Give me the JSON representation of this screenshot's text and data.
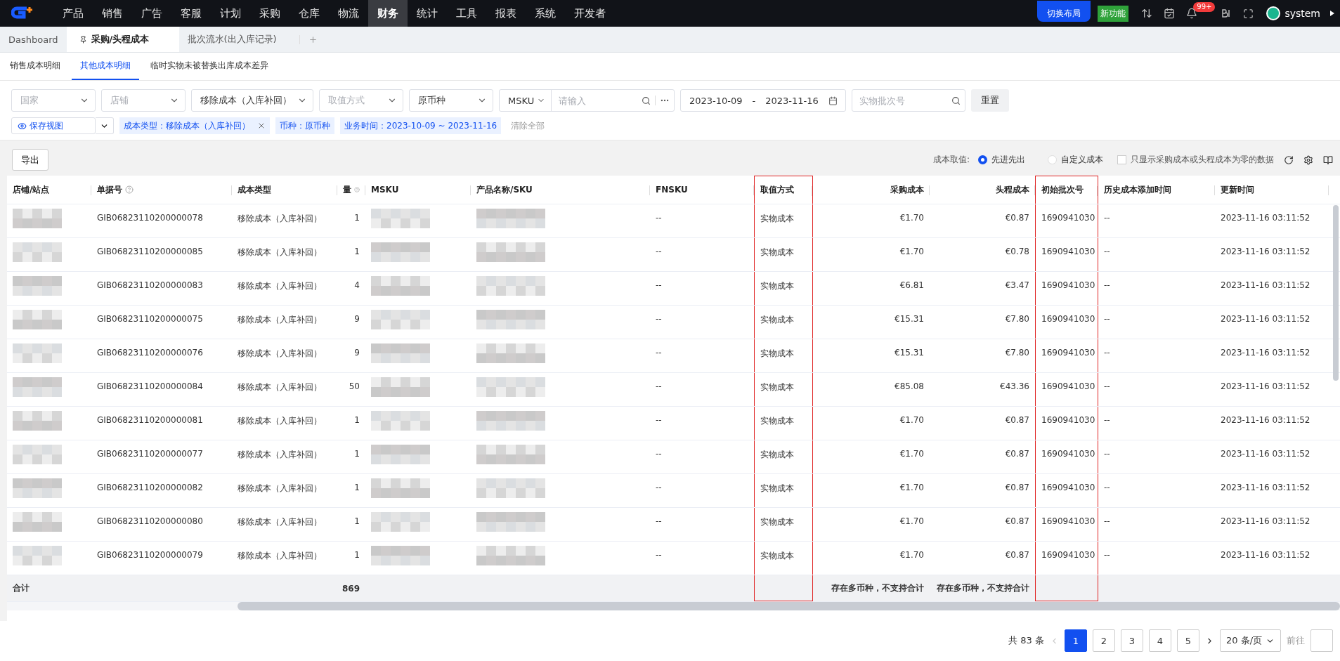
{
  "nav": {
    "items": [
      {
        "label": "产品",
        "selected": false
      },
      {
        "label": "销售",
        "selected": false
      },
      {
        "label": "广告",
        "selected": false
      },
      {
        "label": "客服",
        "selected": false
      },
      {
        "label": "计划",
        "selected": false
      },
      {
        "label": "采购",
        "selected": false
      },
      {
        "label": "仓库",
        "selected": false
      },
      {
        "label": "物流",
        "selected": false
      },
      {
        "label": "财务",
        "selected": true
      },
      {
        "label": "统计",
        "selected": false
      },
      {
        "label": "工具",
        "selected": false
      },
      {
        "label": "报表",
        "selected": false
      },
      {
        "label": "系统",
        "selected": false
      },
      {
        "label": "开发者",
        "selected": false
      }
    ],
    "switch_layout": "切换布局",
    "new_feature": "新功能",
    "notification_count": "99+",
    "user": "system"
  },
  "tabs": [
    {
      "label": "Dashboard",
      "selected": false,
      "pinned": false
    },
    {
      "label": "采购/头程成本",
      "selected": true,
      "pinned": true
    },
    {
      "label": "批次流水(出入库记录)",
      "selected": false,
      "pinned": false
    }
  ],
  "subtabs": [
    {
      "label": "销售成本明细",
      "selected": false
    },
    {
      "label": "其他成本明细",
      "selected": true
    },
    {
      "label": "临时实物未被替换出库成本差异",
      "selected": false
    }
  ],
  "filters": [
    {
      "kind": "select",
      "placeholder": "国家"
    },
    {
      "kind": "select",
      "placeholder": "店铺"
    },
    {
      "kind": "select",
      "value": "移除成本（入库补回）"
    },
    {
      "kind": "select",
      "placeholder": "取值方式"
    },
    {
      "kind": "select",
      "value": "原币种"
    },
    {
      "kind": "msku",
      "value": "MSKU",
      "placeholder": "请输入"
    },
    {
      "kind": "daterange",
      "start": "2023-10-09",
      "separator": "-",
      "end": "2023-11-16"
    },
    {
      "kind": "search",
      "placeholder": "实物批次号"
    },
    {
      "kind": "button",
      "label": "重置"
    }
  ],
  "save_view": "保存视图",
  "chips": [
    {
      "text": "成本类型：移除成本（入库补回）",
      "removable": true
    },
    {
      "text": "币种：原币种",
      "removable": false
    },
    {
      "text": "业务时间：2023-10-09 ~ 2023-11-16",
      "removable": false
    }
  ],
  "clear_all": "清除全部",
  "export": "导出",
  "cost_mode": {
    "label": "成本取值:",
    "options": [
      {
        "label": "先进先出",
        "selected": true
      },
      {
        "label": "自定义成本",
        "selected": false
      }
    ]
  },
  "only_zero": {
    "label": "只显示采购成本或头程成本为零的数据",
    "checked": false
  },
  "table": {
    "columns": [
      {
        "label": "店铺/站点",
        "help": false,
        "highlighted": false
      },
      {
        "label": "单据号",
        "help": true,
        "highlighted": false
      },
      {
        "label": "成本类型",
        "help": false,
        "highlighted": false
      },
      {
        "label": "量",
        "help": true,
        "highlighted": false
      },
      {
        "label": "MSKU",
        "help": false,
        "highlighted": false
      },
      {
        "label": "产品名称/SKU",
        "help": false,
        "highlighted": false
      },
      {
        "label": "FNSKU",
        "help": false,
        "highlighted": false
      },
      {
        "label": "取值方式",
        "help": false,
        "highlighted": true
      },
      {
        "label": "采购成本",
        "help": false,
        "highlighted": false
      },
      {
        "label": "头程成本",
        "help": false,
        "highlighted": false
      },
      {
        "label": "初始批次号",
        "help": false,
        "highlighted": true
      },
      {
        "label": "历史成本添加时间",
        "help": false,
        "highlighted": false
      },
      {
        "label": "更新时间",
        "help": false,
        "highlighted": false
      }
    ],
    "rows": [
      {
        "doc": "GIB06823110200000078",
        "type": "移除成本（入库补回）",
        "qty": "1",
        "fnsku": "--",
        "method": "实物成本",
        "purchase": "€1.70",
        "freight": "€0.87",
        "batch": "1690941030",
        "history": "--",
        "updated": "2023-11-16 03:11:52"
      },
      {
        "doc": "GIB06823110200000085",
        "type": "移除成本（入库补回）",
        "qty": "1",
        "fnsku": "--",
        "method": "实物成本",
        "purchase": "€1.70",
        "freight": "€0.78",
        "batch": "1690941030",
        "history": "--",
        "updated": "2023-11-16 03:11:52"
      },
      {
        "doc": "GIB06823110200000083",
        "type": "移除成本（入库补回）",
        "qty": "4",
        "fnsku": "--",
        "method": "实物成本",
        "purchase": "€6.81",
        "freight": "€3.47",
        "batch": "1690941030",
        "history": "--",
        "updated": "2023-11-16 03:11:52"
      },
      {
        "doc": "GIB06823110200000075",
        "type": "移除成本（入库补回）",
        "qty": "9",
        "fnsku": "--",
        "method": "实物成本",
        "purchase": "€15.31",
        "freight": "€7.80",
        "batch": "1690941030",
        "history": "--",
        "updated": "2023-11-16 03:11:52"
      },
      {
        "doc": "GIB06823110200000076",
        "type": "移除成本（入库补回）",
        "qty": "9",
        "fnsku": "--",
        "method": "实物成本",
        "purchase": "€15.31",
        "freight": "€7.80",
        "batch": "1690941030",
        "history": "--",
        "updated": "2023-11-16 03:11:52"
      },
      {
        "doc": "GIB06823110200000084",
        "type": "移除成本（入库补回）",
        "qty": "50",
        "fnsku": "--",
        "method": "实物成本",
        "purchase": "€85.08",
        "freight": "€43.36",
        "batch": "1690941030",
        "history": "--",
        "updated": "2023-11-16 03:11:52"
      },
      {
        "doc": "GIB06823110200000081",
        "type": "移除成本（入库补回）",
        "qty": "1",
        "fnsku": "--",
        "method": "实物成本",
        "purchase": "€1.70",
        "freight": "€0.87",
        "batch": "1690941030",
        "history": "--",
        "updated": "2023-11-16 03:11:52"
      },
      {
        "doc": "GIB06823110200000077",
        "type": "移除成本（入库补回）",
        "qty": "1",
        "fnsku": "--",
        "method": "实物成本",
        "purchase": "€1.70",
        "freight": "€0.87",
        "batch": "1690941030",
        "history": "--",
        "updated": "2023-11-16 03:11:52"
      },
      {
        "doc": "GIB06823110200000082",
        "type": "移除成本（入库补回）",
        "qty": "1",
        "fnsku": "--",
        "method": "实物成本",
        "purchase": "€1.70",
        "freight": "€0.87",
        "batch": "1690941030",
        "history": "--",
        "updated": "2023-11-16 03:11:52"
      },
      {
        "doc": "GIB06823110200000080",
        "type": "移除成本（入库补回）",
        "qty": "1",
        "fnsku": "--",
        "method": "实物成本",
        "purchase": "€1.70",
        "freight": "€0.87",
        "batch": "1690941030",
        "history": "--",
        "updated": "2023-11-16 03:11:52"
      },
      {
        "doc": "GIB06823110200000079",
        "type": "移除成本（入库补回）",
        "qty": "1",
        "fnsku": "--",
        "method": "实物成本",
        "purchase": "€1.70",
        "freight": "€0.87",
        "batch": "1690941030",
        "history": "--",
        "updated": "2023-11-16 03:11:52"
      }
    ],
    "totals": {
      "label": "合计",
      "qty": "869",
      "purchase": "存在多币种，不支持合计",
      "freight": "存在多币种，不支持合计"
    }
  },
  "pagination": {
    "total": "共 83 条",
    "pages": [
      {
        "label": "1",
        "selected": true
      },
      {
        "label": "2",
        "selected": false
      },
      {
        "label": "3",
        "selected": false
      },
      {
        "label": "4",
        "selected": false
      },
      {
        "label": "5",
        "selected": false
      }
    ],
    "page_size": "20 条/页",
    "goto": "前往"
  }
}
